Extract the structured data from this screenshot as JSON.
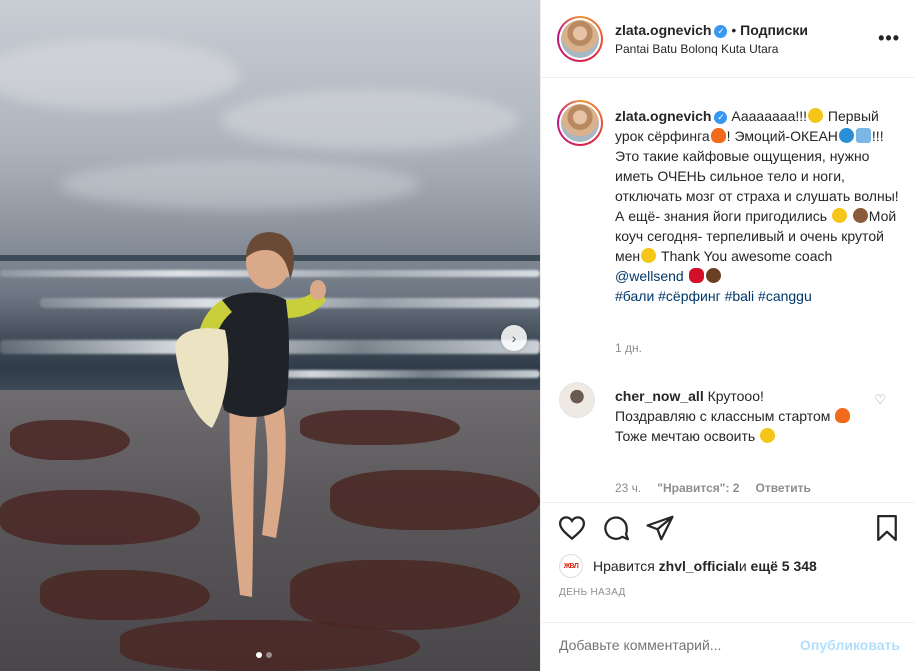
{
  "header": {
    "username": "zlata.ognevich",
    "verified_icon": "verified-badge-icon",
    "separator": "•",
    "follow_label": "Подписки",
    "location": "Pantai Batu Bolonq Kuta Utara",
    "more_icon": "more-options-icon"
  },
  "caption": {
    "username": "zlata.ognevich",
    "text_1": "Аааааааа!!!",
    "text_2": "Первый урок сёрфинга",
    "text_3": "! Эмоций-ОКЕАН",
    "text_4": "!!! Это такие кайфовые ощущения, нужно иметь ОЧЕНЬ сильное тело и ноги, отключать мозг от страха и слушать волны! А ещё- знания йоги пригодились ",
    "text_5": "Мой коуч сегодня- терпеливый и очень крутой мен",
    "text_6": " Thank You awesome coach ",
    "mention": "@wellsend",
    "hashtags": "#бали #сёрфинг #bali #canggu",
    "time": "1 дн."
  },
  "comment": {
    "username": "cher_now_all",
    "text_1": " Крутооо!",
    "text_2": "Поздравляю с классным стартом ",
    "text_3": "Тоже мечтаю освоить ",
    "time": "23 ч.",
    "likes": "\"Нравится\": 2",
    "reply": "Ответить"
  },
  "actions": {
    "like_icon": "heart-icon",
    "comment_icon": "comment-icon",
    "share_icon": "share-icon",
    "save_icon": "bookmark-icon",
    "likes_prefix": "Нравится ",
    "likes_user": "zhvl_official",
    "likes_and": " и ",
    "likes_count": "ещё 5 348",
    "logo_text": "ЖВЛ",
    "date": "ДЕНЬ НАЗАД"
  },
  "add_comment": {
    "placeholder": "Добавьте комментарий...",
    "post_label": "Опубликовать"
  },
  "carousel": {
    "next_icon": "chevron-right-icon",
    "slides": 2,
    "active_slide": 1
  }
}
